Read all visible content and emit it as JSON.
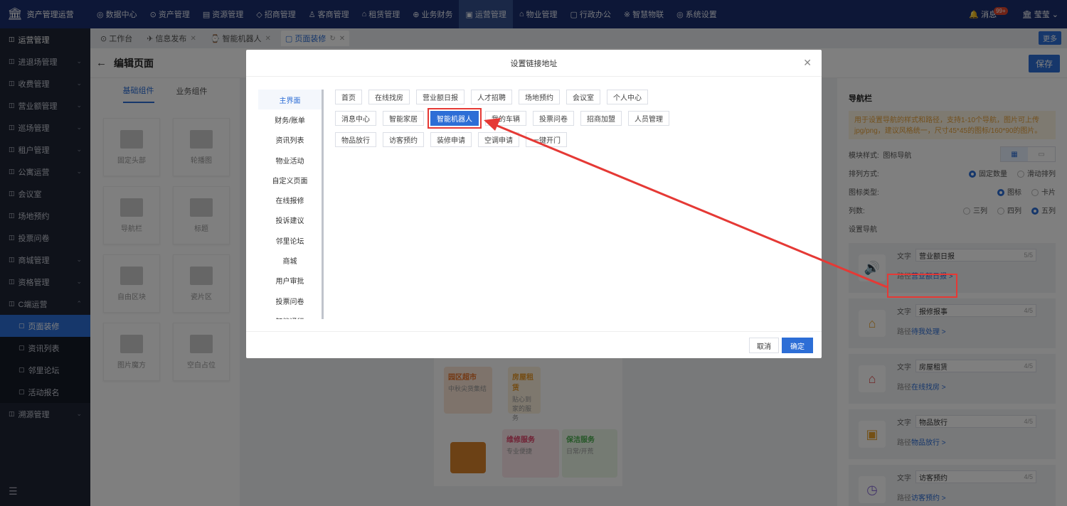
{
  "brand": {
    "name": "资产管理运营"
  },
  "topnav": [
    "数据中心",
    "资产管理",
    "资源管理",
    "招商管理",
    "客商管理",
    "租赁管理",
    "业务财务",
    "运营管理",
    "物业管理",
    "行政办公",
    "智慧物联",
    "系统设置"
  ],
  "topnav_active_index": 7,
  "topright": {
    "messages": "消息",
    "badge": "99+",
    "user": "莹莹"
  },
  "sidebar": {
    "items": [
      {
        "label": "运营管理",
        "sub": false,
        "active": true,
        "chev": false
      },
      {
        "label": "进退场管理",
        "sub": false,
        "chev": true
      },
      {
        "label": "收费管理",
        "sub": false,
        "chev": true
      },
      {
        "label": "营业额管理",
        "sub": false,
        "chev": true
      },
      {
        "label": "巡场管理",
        "sub": false,
        "chev": true
      },
      {
        "label": "租户管理",
        "sub": false,
        "chev": true
      },
      {
        "label": "公寓运营",
        "sub": false,
        "chev": true
      },
      {
        "label": "会议室",
        "sub": false,
        "chev": false
      },
      {
        "label": "场地预约",
        "sub": false,
        "chev": false
      },
      {
        "label": "投票问卷",
        "sub": false,
        "chev": false
      },
      {
        "label": "商城管理",
        "sub": false,
        "chev": true
      },
      {
        "label": "资格管理",
        "sub": false,
        "chev": true
      },
      {
        "label": "C端运营",
        "sub": false,
        "chev": true,
        "open": true
      },
      {
        "label": "页面装修",
        "sub": true,
        "active": true
      },
      {
        "label": "资讯列表",
        "sub": true
      },
      {
        "label": "邻里论坛",
        "sub": true
      },
      {
        "label": "活动报名",
        "sub": true
      },
      {
        "label": "溯源管理",
        "sub": false,
        "chev": true
      }
    ]
  },
  "tabs": [
    {
      "label": "工作台",
      "active": false,
      "close": false
    },
    {
      "label": "信息发布",
      "active": false,
      "close": true
    },
    {
      "label": "智能机器人",
      "active": false,
      "close": true
    },
    {
      "label": "页面装修",
      "active": true,
      "close": true
    }
  ],
  "more_label": "更多",
  "page": {
    "title": "编辑页面",
    "save": "保存"
  },
  "component_tabs": [
    "基础组件",
    "业务组件"
  ],
  "components": [
    "固定头部",
    "轮播图",
    "导航栏",
    "标题",
    "自由区块",
    "瓷片区",
    "图片魔方",
    "空白占位"
  ],
  "preview": {
    "promos": [
      {
        "title": "园区超市",
        "desc": "中秋尖货集结"
      },
      {
        "title": "房屋租赁",
        "desc": "贴心到家的服务"
      },
      {
        "title": "维修服务",
        "desc": "专业便捷"
      },
      {
        "title": "保洁服务",
        "desc": "日常/开荒"
      }
    ]
  },
  "right_panel": {
    "title": "导航栏",
    "tip": "用于设置导航的样式和路径，支持1-10个导航，图片可上传jpg/png，建议风格统一，尺寸45*45的图标/160*90的图片。",
    "module_style_label": "模块样式:",
    "module_style_value": "图标导航",
    "arrange_label": "排列方式:",
    "arrange_options": [
      "固定数量",
      "滑动排列"
    ],
    "icon_type_label": "图标类型:",
    "icon_type_options": [
      "图标",
      "卡片"
    ],
    "columns_label": "列数:",
    "columns_options": [
      "三列",
      "四列",
      "五列"
    ],
    "set_nav_label": "设置导航",
    "text_label": "文字",
    "path_label": "路径",
    "navs": [
      {
        "text": "营业额日报",
        "count": "5/5",
        "path": "营业额日报",
        "icon": "speaker-icon",
        "color": "#e05050"
      },
      {
        "text": "报修报事",
        "count": "4/5",
        "path": "待我处理",
        "icon": "house-repair-icon",
        "color": "#e8a02a"
      },
      {
        "text": "房屋租赁",
        "count": "4/5",
        "path": "在线找房",
        "icon": "house-icon",
        "color": "#e05050"
      },
      {
        "text": "物品放行",
        "count": "4/5",
        "path": "物品放行",
        "icon": "box-icon",
        "color": "#e8a02a"
      },
      {
        "text": "访客预约",
        "count": "4/5",
        "path": "访客预约",
        "icon": "clock-icon",
        "color": "#8a6fd6"
      }
    ]
  },
  "dialog": {
    "title": "设置链接地址",
    "categories": [
      "主界面",
      "财务/账单",
      "资讯列表",
      "物业活动",
      "自定义页面",
      "在线报修",
      "投诉建议",
      "邻里论坛",
      "商城",
      "用户审批",
      "投票问卷",
      "智能通行"
    ],
    "active_category": 0,
    "link_rows": [
      [
        "首页",
        "在线找房",
        "营业额日报",
        "人才招聘",
        "场地预约",
        "会议室",
        "个人中心"
      ],
      [
        "消息中心",
        "智能家居",
        "智能机器人",
        "我的车辆",
        "投票问卷",
        "招商加盟",
        "人员管理"
      ],
      [
        "物品放行",
        "访客预约",
        "装修申请",
        "空调申请",
        "一键开门"
      ]
    ],
    "selected_link": "智能机器人",
    "cancel": "取消",
    "ok": "确定"
  },
  "colors": {
    "primary": "#2d6ed6",
    "topbar": "#1a2e6e",
    "sidebar": "#1f2535",
    "highlight": "#e53935"
  }
}
